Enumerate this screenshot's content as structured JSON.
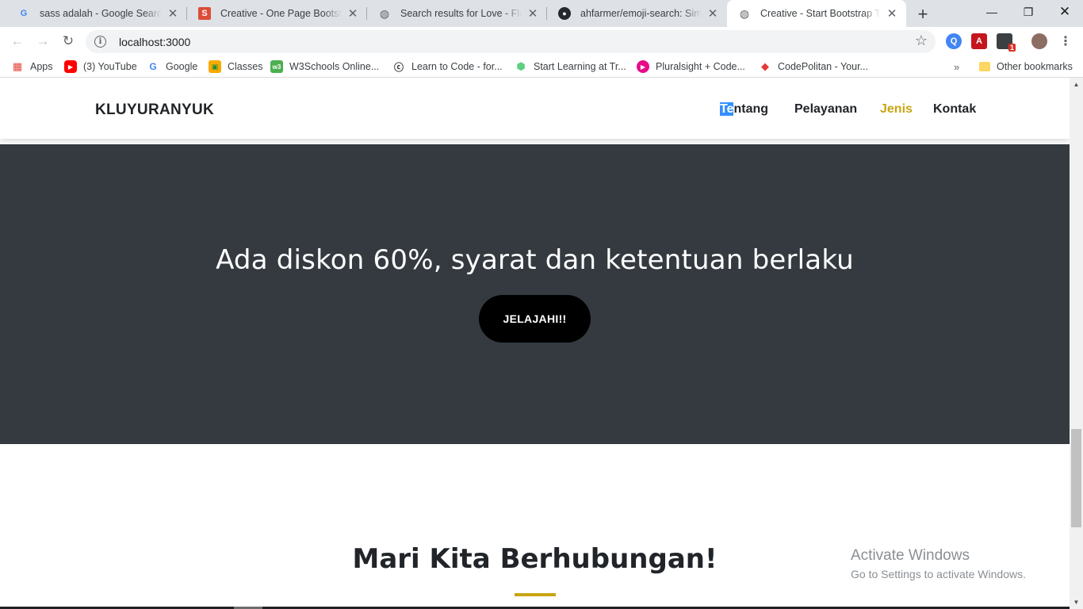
{
  "browser": {
    "tabs": [
      {
        "title": "sass adalah - Google Search",
        "icon": "google-icon"
      },
      {
        "title": "Creative - One Page Bootstrap",
        "icon": "startbootstrap-icon"
      },
      {
        "title": "Search results for Love - Flaticon",
        "icon": "globe-icon"
      },
      {
        "title": "ahfarmer/emoji-search: Simple",
        "icon": "github-icon"
      },
      {
        "title": "Creative - Start Bootstrap Theme",
        "icon": "globe-icon"
      }
    ],
    "active_tab_index": 4,
    "url": "localhost:3000",
    "bookmarks": [
      {
        "label": "Apps",
        "icon": "apps-grid-icon"
      },
      {
        "label": "(3) YouTube",
        "icon": "youtube-icon"
      },
      {
        "label": "Google",
        "icon": "google-icon"
      },
      {
        "label": "Classes",
        "icon": "classes-icon"
      },
      {
        "label": "W3Schools Online...",
        "icon": "w3schools-icon"
      },
      {
        "label": "Learn to Code - for...",
        "icon": "freecodecamp-icon"
      },
      {
        "label": "Start Learning at Tr...",
        "icon": "treehouse-icon"
      },
      {
        "label": "Pluralsight + Code...",
        "icon": "pluralsight-icon"
      },
      {
        "label": "CodePolitan - Your...",
        "icon": "codepolitan-icon"
      }
    ],
    "other_bookmarks": "Other bookmarks",
    "extension_badge": "1"
  },
  "site": {
    "brand": "KLUYURANYUK",
    "nav": [
      {
        "label": "Tentang",
        "highlighted": "Te",
        "rest": "ntang"
      },
      {
        "label": "Pelayanan"
      },
      {
        "label": "Jenis",
        "active": true
      },
      {
        "label": "Kontak"
      }
    ],
    "promo": {
      "heading": "Ada diskon 60%, syarat dan ketentuan berlaku",
      "button": "JELAJAHI!!"
    },
    "contact": {
      "heading": "Mari Kita Berhubungan!"
    },
    "accent_color": "#c9a514",
    "dark_bg": "#343a40"
  },
  "os": {
    "watermark_title": "Activate Windows",
    "watermark_subtitle": "Go to Settings to activate Windows."
  }
}
